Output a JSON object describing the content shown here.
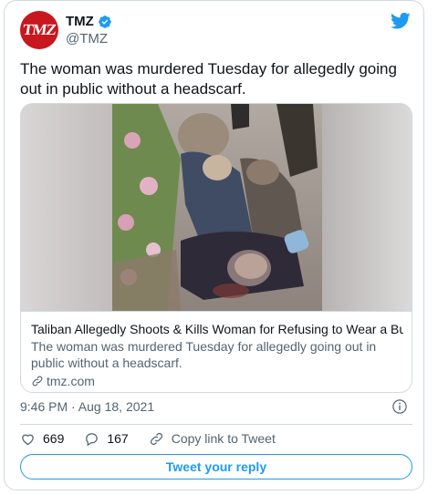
{
  "author": {
    "display_name": "TMZ",
    "handle": "@TMZ",
    "avatar_text": "TMZ",
    "verified_icon": "verified-badge-icon",
    "brand_color": "#c8171e"
  },
  "platform_icon": "twitter-bird-icon",
  "tweet": {
    "text": "The woman was murdered Tuesday for allegedly going out in public without a headscarf.",
    "timestamp": "9:46 PM · Aug 18, 2021"
  },
  "link_card": {
    "image_icon": "news-photo",
    "title": "Taliban Allegedly Shoots & Kills Woman for Refusing to Wear a Bu...",
    "description": "The woman was murdered Tuesday for allegedly going out in public without a headscarf.",
    "domain": "tmz.com"
  },
  "actions": {
    "likes": "669",
    "replies": "167",
    "copy_link_label": "Copy link to Tweet"
  },
  "reply_button": "Tweet your reply",
  "colors": {
    "accent": "#1d9bf0",
    "text_secondary": "#536471",
    "border": "#cfd9de"
  }
}
